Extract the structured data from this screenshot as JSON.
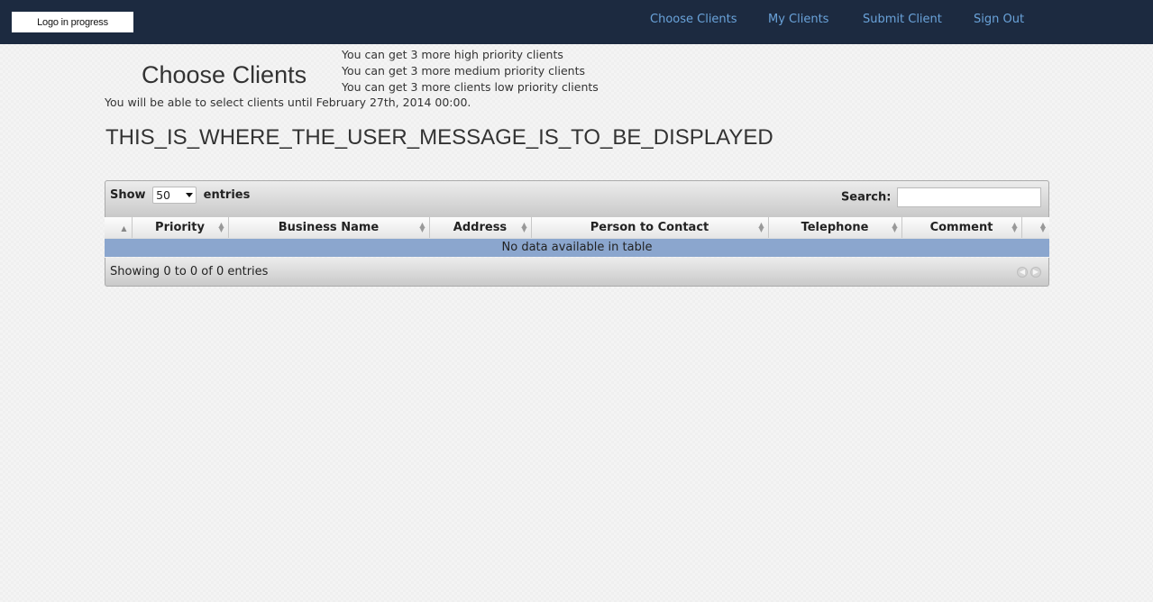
{
  "header": {
    "logo_text": "Logo in progress",
    "nav": [
      {
        "label": "Choose Clients"
      },
      {
        "label": "My Clients"
      },
      {
        "label": "Submit Client"
      },
      {
        "label": "Sign Out"
      }
    ],
    "colors": {
      "navbar_bg": "#1c2a40",
      "link": "#6aa3da"
    }
  },
  "main": {
    "title": "Choose Clients",
    "quotas": [
      "You can get 3 more high priority clients",
      "You can get 3 more medium priority clients",
      "You can get 3 more clients low priority clients"
    ],
    "deadline": "You will be able to select clients until February 27th, 2014 00:00.",
    "user_message": "THIS_IS_WHERE_THE_USER_MESSAGE_IS_TO_BE_DISPLAYED"
  },
  "table": {
    "show_label": "Show",
    "entries_value": "50",
    "entries_label": "entries",
    "search_label": "Search:",
    "search_value": "",
    "columns": [
      "",
      "Priority",
      "Business Name",
      "Address",
      "Person to Contact",
      "Telephone",
      "Comment",
      ""
    ],
    "empty_message": "No data available in table",
    "info": "Showing 0 to 0 of 0 entries",
    "empty_row_color": "#8ba6ce",
    "pager": {
      "prev_icon": "arrow-left-icon",
      "next_icon": "arrow-right-icon"
    }
  }
}
